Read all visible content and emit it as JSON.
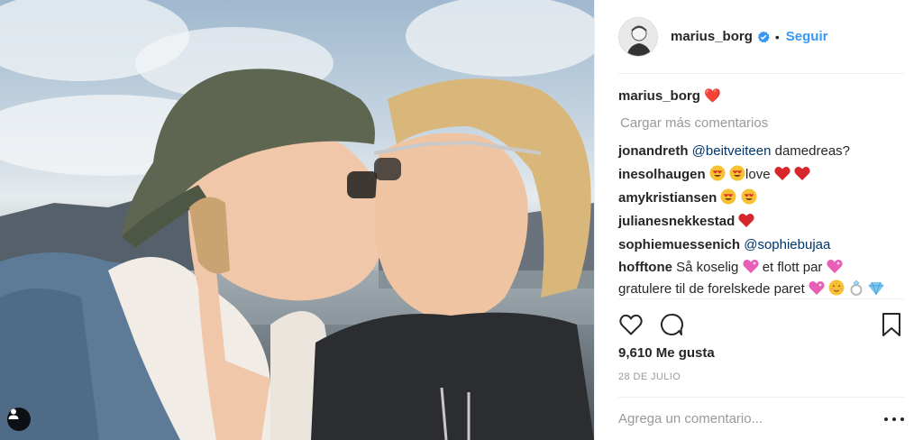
{
  "post": {
    "author": "marius_borg",
    "follow_label": "Seguir",
    "separator": "•",
    "verified_icon": "verified-badge-icon",
    "caption_emoji": "❤️",
    "load_more_label": "Cargar más comentarios",
    "comments": [
      {
        "user": "jonandreth",
        "mention": "@beitveiteen",
        "text": " damedreas?"
      },
      {
        "user": "inesolhaugen",
        "text": "love"
      },
      {
        "user": "amykristiansen",
        "text": ""
      },
      {
        "user": "julianesnekkestad",
        "text": ""
      },
      {
        "user": "sophiemuessenich",
        "mention": "@sophiebujaa",
        "text": ""
      },
      {
        "user": "hofftone",
        "text_a": " Så koselig ",
        "text_b": " et flott par ",
        "text_c": "gratulere til de forelskede paret "
      }
    ],
    "likes_text": "9,610 Me gusta",
    "date_text": "28 DE JULIO",
    "comment_placeholder": "Agrega un comentario...",
    "icons": [
      "heart-icon",
      "comment-icon",
      "bookmark-icon",
      "more-options-icon",
      "user-tag-icon"
    ],
    "colors": {
      "accent": "#3897f0",
      "text": "#262626",
      "muted": "#999999",
      "border": "#efefef",
      "heart_red": "#e0262c"
    }
  }
}
